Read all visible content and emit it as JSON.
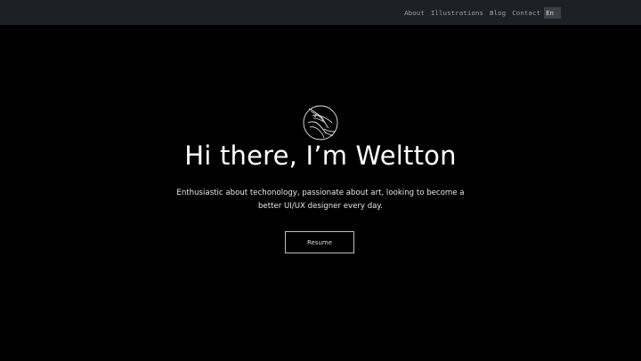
{
  "nav": {
    "links": [
      "About",
      "Illustrations",
      "Blog",
      "Contact"
    ],
    "language": "En"
  },
  "hero": {
    "logo_icon": "bird-circle-logo-icon",
    "title": "Hi there, I’m Weltton",
    "subtitle": "Enthusiastic about techonology, passionate about art, looking to become a better UI/UX designer every day.",
    "resume_label": "Resume"
  },
  "colors": {
    "background": "#000000",
    "topbar": "#1d2024",
    "nav_text": "#9aa0a6",
    "language_bg": "#3c4046"
  }
}
